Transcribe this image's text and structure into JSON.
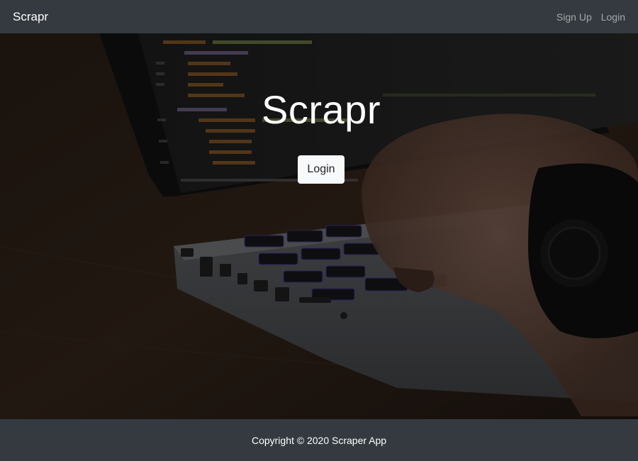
{
  "navbar": {
    "brand": "Scrapr",
    "links": [
      {
        "label": "Sign Up"
      },
      {
        "label": "Login"
      }
    ]
  },
  "hero": {
    "title": "Scrapr",
    "login_button": "Login",
    "background_image": "laptop-typing-photo"
  },
  "footer": {
    "copyright": "Copyright © 2020 Scraper App"
  },
  "colors": {
    "navbar_bg": "#343a40",
    "footer_bg": "#343a40",
    "button_bg": "#f8f9fa",
    "nav_link": "rgba(255,255,255,0.55)"
  }
}
